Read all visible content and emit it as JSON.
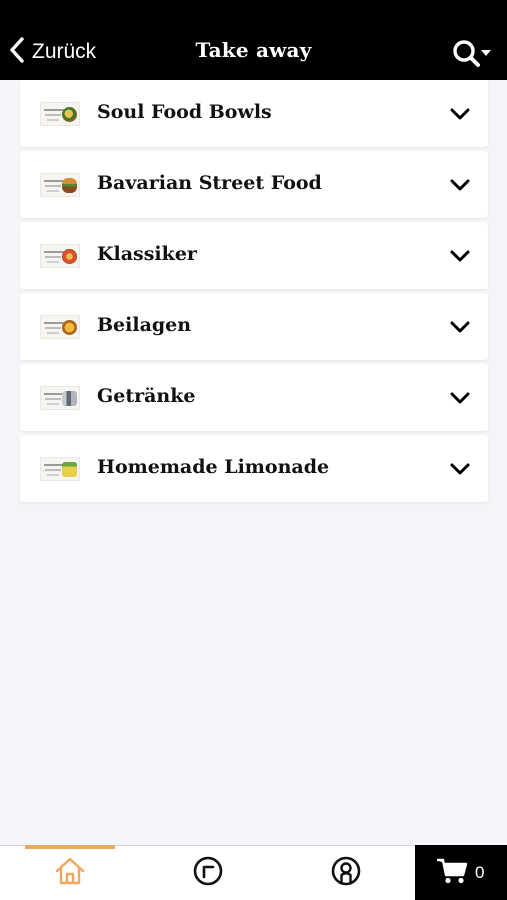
{
  "header": {
    "back_label": "Zurück",
    "title": "Take away",
    "search_icon": "search-dropdown-icon"
  },
  "categories": [
    {
      "label": "Soul Food Bowls",
      "thumb_color": "#c9961f"
    },
    {
      "label": "Bavarian Street Food",
      "thumb_color": "#d4893a"
    },
    {
      "label": "Klassiker",
      "thumb_color": "#d9532b"
    },
    {
      "label": "Beilagen",
      "thumb_color": "#d08a1e"
    },
    {
      "label": "Getränke",
      "thumb_color": "#6f7a88"
    },
    {
      "label": "Homemade Limonade",
      "thumb_color": "#cfb23a"
    }
  ],
  "bottom_nav": {
    "items": [
      {
        "icon": "home-icon",
        "active": true
      },
      {
        "icon": "history-icon",
        "active": false
      },
      {
        "icon": "account-icon",
        "active": false
      }
    ],
    "cart_icon": "cart-icon",
    "cart_count": "0"
  },
  "colors": {
    "accent": "#f0a85e",
    "header_bg": "#000000",
    "page_bg": "#f3f5f9"
  }
}
